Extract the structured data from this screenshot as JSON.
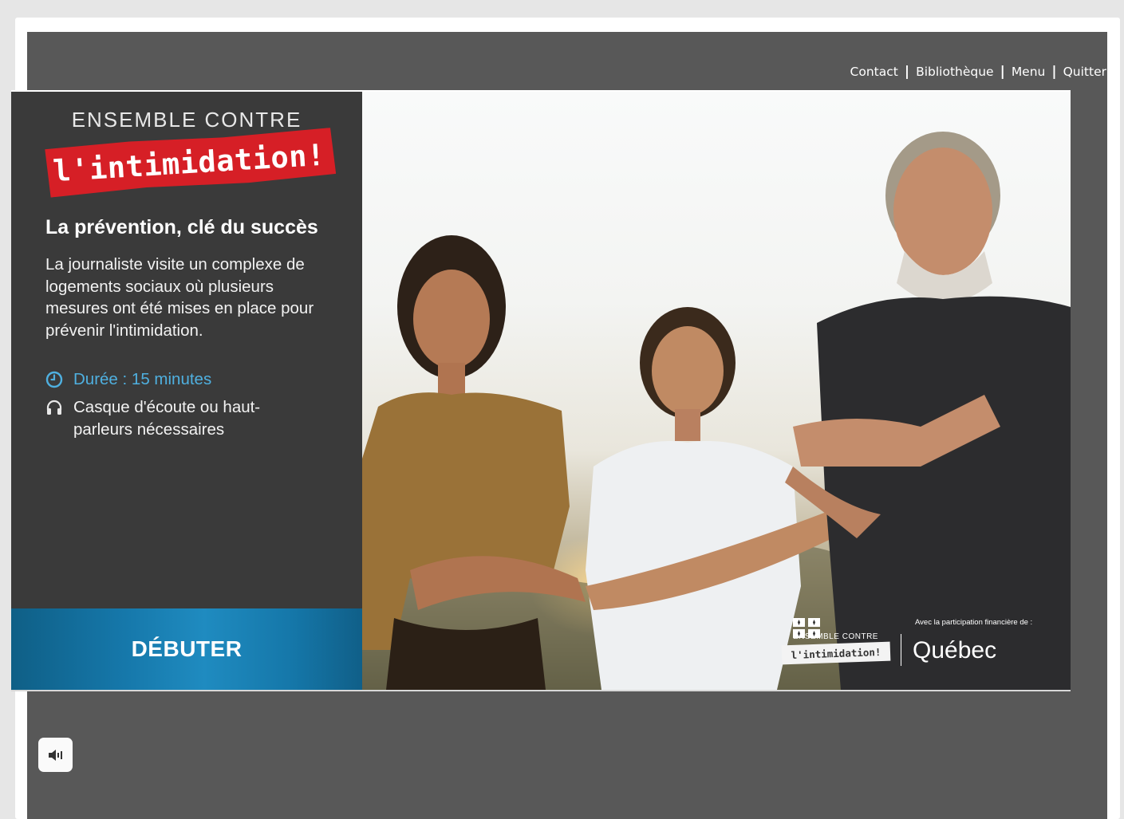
{
  "nav": {
    "contact": "Contact",
    "library": "Bibliothèque",
    "menu": "Menu",
    "quit": "Quitter",
    "separator": "|"
  },
  "brand": {
    "top_line": "ENSEMBLE CONTRE",
    "banner": "l'intimidation!"
  },
  "course": {
    "title": "La prévention, clé du succès",
    "description": "La journaliste visite un complexe de logements sociaux où plusieurs mesures ont été mises en place pour prévenir l'intimidation.",
    "duration": "Durée : 15 minutes",
    "audio_note": "Casque d'écoute ou haut-parleurs nécessaires"
  },
  "start_button": "DÉBUTER",
  "photo_logos": {
    "campaign_top": "ENSEMBLE CONTRE",
    "campaign_banner": "l'intimidation!",
    "funding_note": "Avec la participation financière de :",
    "government": "Québec"
  },
  "colors": {
    "player_bg": "#585858",
    "panel_bg": "#3a3a3a",
    "accent_red": "#d61f26",
    "accent_blue": "#1f8bc0",
    "duration_text": "#4fb0e0"
  },
  "icons": {
    "duration": "clock-icon",
    "audio": "headphones-icon",
    "sound": "speaker-icon"
  }
}
